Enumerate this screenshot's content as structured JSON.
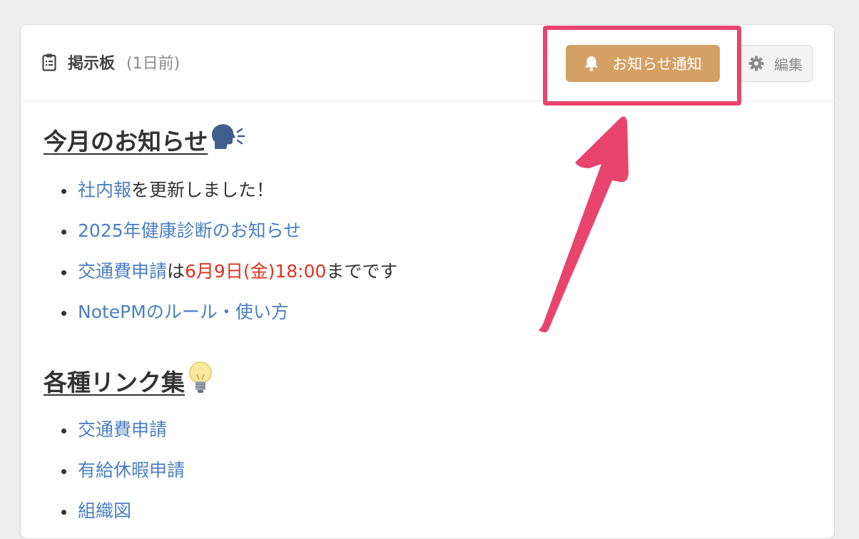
{
  "header": {
    "title": "掲示板",
    "time": "(1日前)",
    "notify_label": "お知らせ通知",
    "edit_label": "編集"
  },
  "sections": [
    {
      "heading": "今月のお知らせ",
      "emoji": "speaking-head",
      "items": [
        {
          "link": "社内報",
          "text": "を更新しました！"
        },
        {
          "link": "2025年健康診断のお知らせ"
        },
        {
          "link": "交通費申請",
          "text_before_red": "は",
          "red": "6月9日(金)18:00",
          "text_after_red": "までです"
        },
        {
          "link": "NotePMのルール・使い方"
        }
      ]
    },
    {
      "heading": "各種リンク集",
      "emoji": "light-bulb",
      "items": [
        {
          "link": "交通費申請"
        },
        {
          "link": "有給休暇申請"
        },
        {
          "link": "組織図"
        }
      ]
    }
  ],
  "colors": {
    "accent_button": "#d4a064",
    "link": "#4a7fc1",
    "deadline_red": "#e0321e",
    "annotation_pink": "#e8446e"
  }
}
